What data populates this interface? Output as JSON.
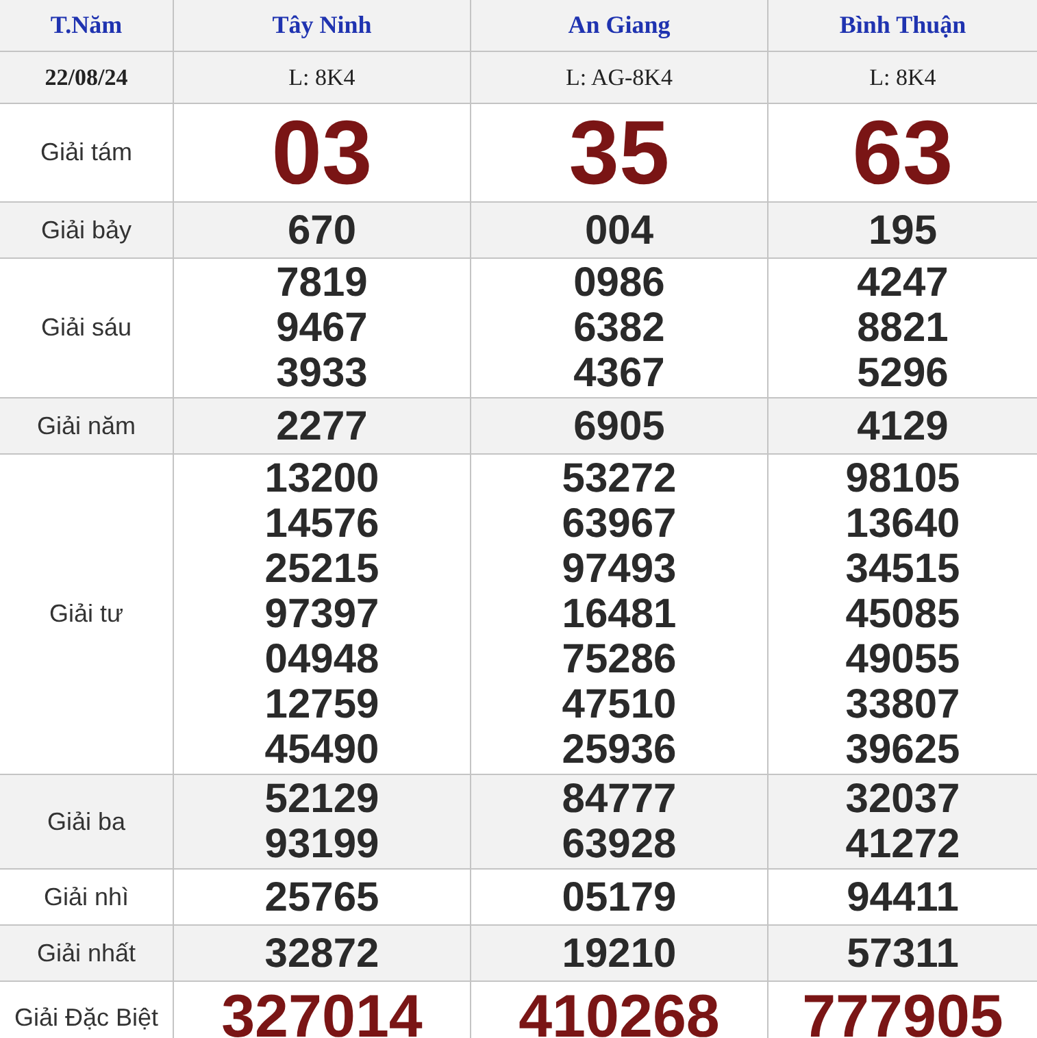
{
  "header": {
    "day": "T.Năm",
    "provinces": [
      "Tây Ninh",
      "An Giang",
      "Bình Thuận"
    ]
  },
  "draw": {
    "date": "22/08/24",
    "tickets": [
      "L: 8K4",
      "L: AG-8K4",
      "L: 8K4"
    ]
  },
  "prizes": [
    {
      "label": "Giải tám",
      "kind": "big",
      "results": [
        [
          "03"
        ],
        [
          "35"
        ],
        [
          "63"
        ]
      ]
    },
    {
      "label": "Giải bảy",
      "kind": "normal",
      "results": [
        [
          "670"
        ],
        [
          "004"
        ],
        [
          "195"
        ]
      ]
    },
    {
      "label": "Giải sáu",
      "kind": "normal",
      "results": [
        [
          "7819",
          "9467",
          "3933"
        ],
        [
          "0986",
          "6382",
          "4367"
        ],
        [
          "4247",
          "8821",
          "5296"
        ]
      ]
    },
    {
      "label": "Giải năm",
      "kind": "normal",
      "results": [
        [
          "2277"
        ],
        [
          "6905"
        ],
        [
          "4129"
        ]
      ]
    },
    {
      "label": "Giải tư",
      "kind": "normal",
      "results": [
        [
          "13200",
          "14576",
          "25215",
          "97397",
          "04948",
          "12759",
          "45490"
        ],
        [
          "53272",
          "63967",
          "97493",
          "16481",
          "75286",
          "47510",
          "25936"
        ],
        [
          "98105",
          "13640",
          "34515",
          "45085",
          "49055",
          "33807",
          "39625"
        ]
      ]
    },
    {
      "label": "Giải ba",
      "kind": "normal",
      "results": [
        [
          "52129",
          "93199"
        ],
        [
          "84777",
          "63928"
        ],
        [
          "32037",
          "41272"
        ]
      ]
    },
    {
      "label": "Giải nhì",
      "kind": "normal",
      "results": [
        [
          "25765"
        ],
        [
          "05179"
        ],
        [
          "94411"
        ]
      ]
    },
    {
      "label": "Giải nhất",
      "kind": "normal",
      "results": [
        [
          "32872"
        ],
        [
          "19210"
        ],
        [
          "57311"
        ]
      ]
    },
    {
      "label": "Giải Đặc Biệt",
      "kind": "special",
      "results": [
        [
          "327014"
        ],
        [
          "410268"
        ],
        [
          "777905"
        ]
      ]
    }
  ]
}
